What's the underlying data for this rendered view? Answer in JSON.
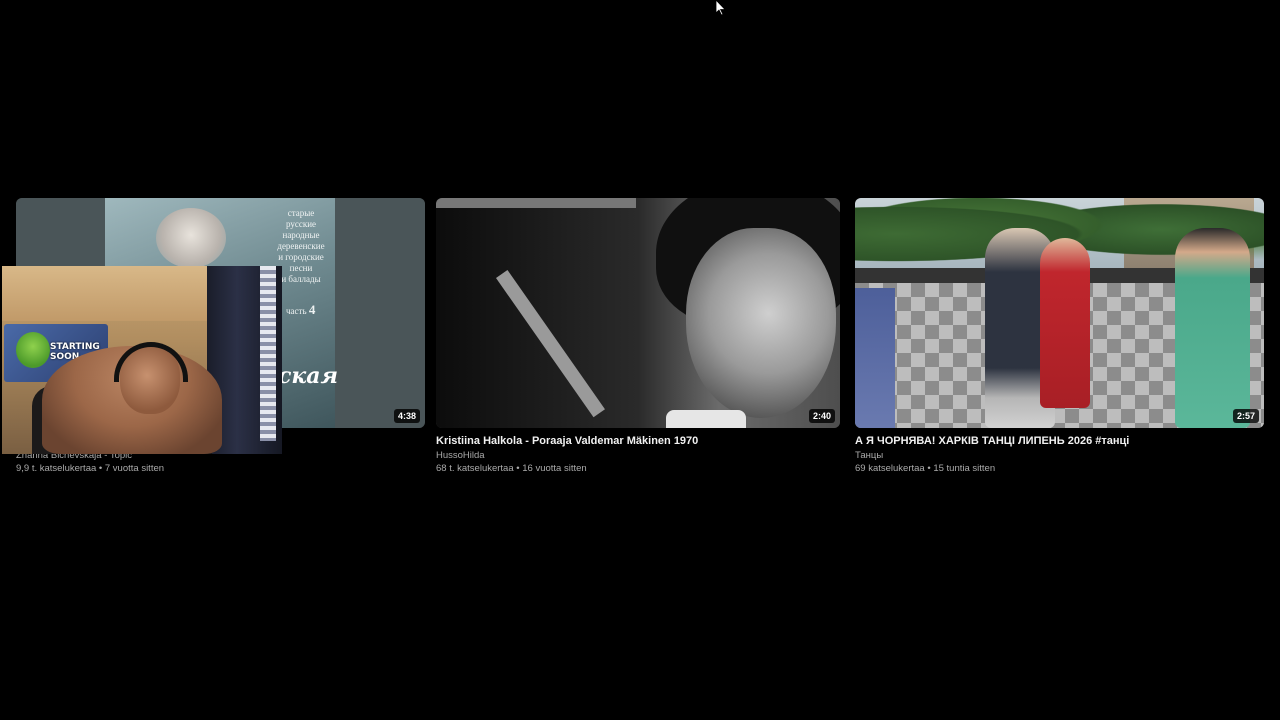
{
  "videos": [
    {
      "title": "",
      "channel": "Zhanna Bichevskaja - Topic",
      "stats": "9,9 t. katselukertaa • 7 vuotta sitten",
      "duration": "4:38",
      "thumb_text": {
        "lines": [
          "старые",
          "русские",
          "народные",
          "деревенские",
          "и городские",
          "песни",
          "и баллады"
        ],
        "part_word": "часть",
        "part_number": "4",
        "script_word": "ская"
      }
    },
    {
      "title": "Kristiina Halkola - Poraaja Valdemar Mäkinen 1970",
      "channel": "HussoHilda",
      "stats": "68 t. katselukertaa • 16 vuotta sitten",
      "duration": "2:40"
    },
    {
      "title": "А Я ЧОРНЯВА! ХАРКІВ ТАНЦІ ЛИПЕНЬ 2026 #танці",
      "channel": "Танцы",
      "stats": "69 katselukertaa • 15 tuntia sitten",
      "duration": "2:57"
    }
  ],
  "webcam": {
    "poster_line1": "STARTING",
    "poster_line2": "SOON"
  },
  "colors": {
    "background": "#000000",
    "title": "#f1f1f1",
    "secondary_text": "#aaaaaa"
  }
}
